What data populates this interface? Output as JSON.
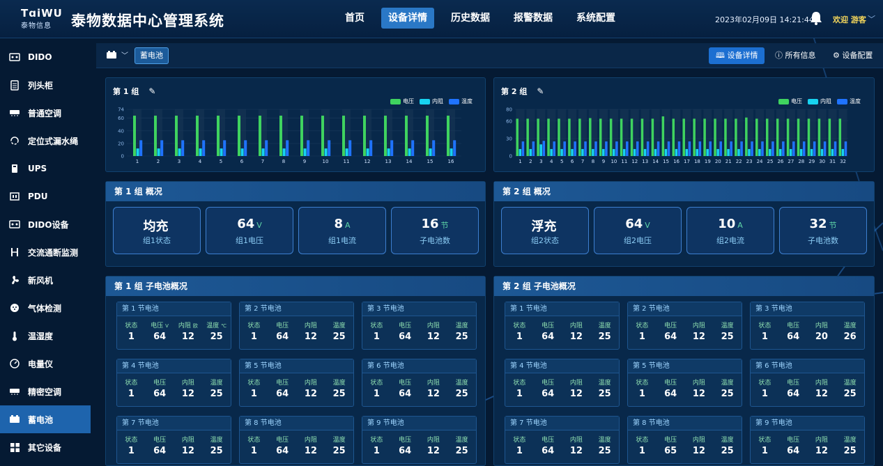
{
  "header": {
    "logo_mark": "TɑiWU",
    "logo_sub": "泰物信息",
    "title": "泰物数据中心管理系统",
    "nav": [
      {
        "label": "首页",
        "active": false
      },
      {
        "label": "设备详情",
        "active": true
      },
      {
        "label": "历史数据",
        "active": false
      },
      {
        "label": "报警数据",
        "active": false
      },
      {
        "label": "系统配置",
        "active": false
      }
    ],
    "datetime": "2023年02月09日 14:21:44",
    "welcome": "欢迎 游客",
    "accent": "#2a78c6"
  },
  "sidebar": {
    "items": [
      {
        "label": "DIDO",
        "icon": "dido-icon"
      },
      {
        "label": "列头柜",
        "icon": "cabinet-icon"
      },
      {
        "label": "普通空调",
        "icon": "air-conditioner-icon"
      },
      {
        "label": "定位式漏水绳",
        "icon": "water-leak-icon"
      },
      {
        "label": "UPS",
        "icon": "ups-icon"
      },
      {
        "label": "PDU",
        "icon": "pdu-icon"
      },
      {
        "label": "DIDO设备",
        "icon": "dido-device-icon"
      },
      {
        "label": "交流通断监测",
        "icon": "ac-monitor-icon"
      },
      {
        "label": "新风机",
        "icon": "fan-icon"
      },
      {
        "label": "气体检测",
        "icon": "gas-icon"
      },
      {
        "label": "温湿度",
        "icon": "thermometer-icon"
      },
      {
        "label": "电量仪",
        "icon": "meter-icon"
      },
      {
        "label": "精密空调",
        "icon": "precision-ac-icon"
      },
      {
        "label": "蓄电池",
        "icon": "battery-icon",
        "active": true
      },
      {
        "label": "其它设备",
        "icon": "grid-icon"
      }
    ],
    "active_color": "#1e64ad"
  },
  "toolbar": {
    "device_tag": "蓄电池",
    "btn_detail": "设备详情",
    "btn_all": "所有信息",
    "btn_config": "设备配置"
  },
  "legend": {
    "voltage": "电压",
    "resistance": "内阻",
    "temperature": "温度"
  },
  "colors": {
    "voltage": "#3fd35f",
    "resistance": "#17d3f0",
    "temperature": "#1f73ff",
    "track": "#1a3656"
  },
  "groups": [
    {
      "chart_title": "第 1 组",
      "summary_title": "第 1 组 概况",
      "cells_title": "第 1 组 子电池概况",
      "stats": [
        {
          "value": "均充",
          "unit": "",
          "label": "组1状态"
        },
        {
          "value": "64",
          "unit": "V",
          "label": "组1电压"
        },
        {
          "value": "8",
          "unit": "A",
          "label": "组1电流"
        },
        {
          "value": "16",
          "unit": "节",
          "label": "子电池数"
        }
      ],
      "cells": [
        {
          "title": "第 1 节电池",
          "labels": [
            "状态",
            "电压",
            "内阻",
            "温度"
          ],
          "units": [
            "",
            "V",
            "欧",
            "℃"
          ],
          "values": [
            "1",
            "64",
            "12",
            "25"
          ]
        },
        {
          "title": "第 2 节电池",
          "labels": [
            "状态",
            "电压",
            "内阻",
            "温度"
          ],
          "units": [
            "",
            "",
            "",
            ""
          ],
          "values": [
            "1",
            "64",
            "12",
            "25"
          ]
        },
        {
          "title": "第 3 节电池",
          "labels": [
            "状态",
            "电压",
            "内阻",
            "温度"
          ],
          "units": [
            "",
            "",
            "",
            ""
          ],
          "values": [
            "1",
            "64",
            "12",
            "25"
          ]
        },
        {
          "title": "第 4 节电池",
          "labels": [
            "状态",
            "电压",
            "内阻",
            "温度"
          ],
          "units": [
            "",
            "",
            "",
            ""
          ],
          "values": [
            "1",
            "64",
            "12",
            "25"
          ]
        },
        {
          "title": "第 5 节电池",
          "labels": [
            "状态",
            "电压",
            "内阻",
            "温度"
          ],
          "units": [
            "",
            "",
            "",
            ""
          ],
          "values": [
            "1",
            "64",
            "12",
            "25"
          ]
        },
        {
          "title": "第 6 节电池",
          "labels": [
            "状态",
            "电压",
            "内阻",
            "温度"
          ],
          "units": [
            "",
            "",
            "",
            ""
          ],
          "values": [
            "1",
            "64",
            "12",
            "25"
          ]
        },
        {
          "title": "第 7 节电池",
          "labels": [
            "状态",
            "电压",
            "内阻",
            "温度"
          ],
          "units": [
            "",
            "",
            "",
            ""
          ],
          "values": [
            "1",
            "64",
            "12",
            "25"
          ]
        },
        {
          "title": "第 8 节电池",
          "labels": [
            "状态",
            "电压",
            "内阻",
            "温度"
          ],
          "units": [
            "",
            "",
            "",
            ""
          ],
          "values": [
            "1",
            "64",
            "12",
            "25"
          ]
        },
        {
          "title": "第 9 节电池",
          "labels": [
            "状态",
            "电压",
            "内阻",
            "温度"
          ],
          "units": [
            "",
            "",
            "",
            ""
          ],
          "values": [
            "1",
            "64",
            "12",
            "25"
          ]
        }
      ]
    },
    {
      "chart_title": "第 2 组",
      "summary_title": "第 2 组 概况",
      "cells_title": "第 2 组 子电池概况",
      "stats": [
        {
          "value": "浮充",
          "unit": "",
          "label": "组2状态"
        },
        {
          "value": "64",
          "unit": "V",
          "label": "组2电压"
        },
        {
          "value": "10",
          "unit": "A",
          "label": "组2电流"
        },
        {
          "value": "32",
          "unit": "节",
          "label": "子电池数"
        }
      ],
      "cells": [
        {
          "title": "第 1 节电池",
          "labels": [
            "状态",
            "电压",
            "内阻",
            "温度"
          ],
          "units": [
            "",
            "",
            "",
            ""
          ],
          "values": [
            "1",
            "64",
            "12",
            "25"
          ]
        },
        {
          "title": "第 2 节电池",
          "labels": [
            "状态",
            "电压",
            "内阻",
            "温度"
          ],
          "units": [
            "",
            "",
            "",
            ""
          ],
          "values": [
            "1",
            "64",
            "12",
            "25"
          ]
        },
        {
          "title": "第 3 节电池",
          "labels": [
            "状态",
            "电压",
            "内阻",
            "温度"
          ],
          "units": [
            "",
            "",
            "",
            ""
          ],
          "values": [
            "1",
            "64",
            "20",
            "26"
          ]
        },
        {
          "title": "第 4 节电池",
          "labels": [
            "状态",
            "电压",
            "内阻",
            "温度"
          ],
          "units": [
            "",
            "",
            "",
            ""
          ],
          "values": [
            "1",
            "64",
            "12",
            "25"
          ]
        },
        {
          "title": "第 5 节电池",
          "labels": [
            "状态",
            "电压",
            "内阻",
            "温度"
          ],
          "units": [
            "",
            "",
            "",
            ""
          ],
          "values": [
            "1",
            "64",
            "12",
            "25"
          ]
        },
        {
          "title": "第 6 节电池",
          "labels": [
            "状态",
            "电压",
            "内阻",
            "温度"
          ],
          "units": [
            "",
            "",
            "",
            ""
          ],
          "values": [
            "1",
            "64",
            "12",
            "25"
          ]
        },
        {
          "title": "第 7 节电池",
          "labels": [
            "状态",
            "电压",
            "内阻",
            "温度"
          ],
          "units": [
            "",
            "",
            "",
            ""
          ],
          "values": [
            "1",
            "64",
            "12",
            "25"
          ]
        },
        {
          "title": "第 8 节电池",
          "labels": [
            "状态",
            "电压",
            "内阻",
            "温度"
          ],
          "units": [
            "",
            "",
            "",
            ""
          ],
          "values": [
            "1",
            "65",
            "12",
            "25"
          ]
        },
        {
          "title": "第 9 节电池",
          "labels": [
            "状态",
            "电压",
            "内阻",
            "温度"
          ],
          "units": [
            "",
            "",
            "",
            ""
          ],
          "values": [
            "1",
            "64",
            "12",
            "25"
          ]
        }
      ]
    }
  ],
  "chart_data": [
    {
      "type": "bar",
      "x": [
        1,
        2,
        3,
        4,
        5,
        6,
        7,
        8,
        9,
        10,
        11,
        12,
        13,
        14,
        15,
        16
      ],
      "yticks": [
        0,
        20,
        40,
        60,
        74
      ],
      "ylim": [
        0,
        74
      ],
      "series": [
        {
          "name": "电压",
          "values": [
            64,
            64,
            64,
            64,
            64,
            64,
            64,
            64,
            64,
            64,
            64,
            64,
            64,
            64,
            64,
            64
          ]
        },
        {
          "name": "内阻",
          "values": [
            12,
            12,
            12,
            12,
            12,
            12,
            12,
            12,
            12,
            12,
            12,
            12,
            12,
            12,
            12,
            12
          ]
        },
        {
          "name": "温度",
          "values": [
            25,
            25,
            25,
            25,
            25,
            25,
            25,
            25,
            25,
            25,
            25,
            25,
            25,
            25,
            25,
            25
          ]
        }
      ]
    },
    {
      "type": "bar",
      "x": [
        1,
        2,
        3,
        4,
        5,
        6,
        7,
        8,
        9,
        10,
        11,
        12,
        13,
        14,
        15,
        16,
        17,
        18,
        19,
        20,
        21,
        22,
        23,
        24,
        25,
        26,
        27,
        28,
        29,
        30,
        31,
        32
      ],
      "yticks": [
        0,
        30,
        60,
        80
      ],
      "ylim": [
        0,
        80
      ],
      "series": [
        {
          "name": "电压",
          "values": [
            64,
            64,
            64,
            64,
            64,
            64,
            64,
            65,
            64,
            64,
            64,
            64,
            64,
            64,
            68,
            64,
            64,
            64,
            64,
            64,
            64,
            64,
            66,
            64,
            64,
            64,
            64,
            64,
            64,
            64,
            64,
            64
          ]
        },
        {
          "name": "内阻",
          "values": [
            12,
            12,
            20,
            12,
            12,
            12,
            12,
            12,
            12,
            12,
            12,
            12,
            12,
            12,
            12,
            12,
            12,
            12,
            12,
            12,
            12,
            12,
            12,
            12,
            12,
            12,
            12,
            12,
            12,
            12,
            12,
            12
          ]
        },
        {
          "name": "温度",
          "values": [
            25,
            25,
            26,
            25,
            25,
            25,
            25,
            25,
            25,
            25,
            25,
            25,
            25,
            25,
            25,
            25,
            25,
            25,
            25,
            25,
            25,
            25,
            25,
            25,
            25,
            25,
            25,
            25,
            25,
            25,
            25,
            25
          ]
        }
      ]
    }
  ]
}
